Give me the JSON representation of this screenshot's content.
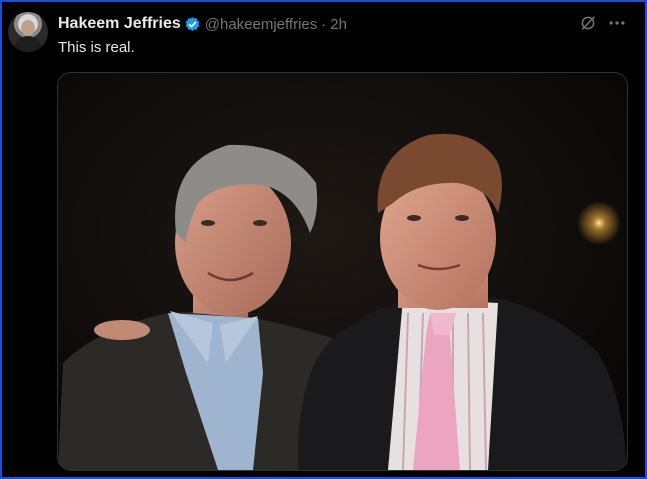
{
  "tweet": {
    "display_name": "Hakeem Jeffries",
    "handle": "@hakeemjeffries",
    "separator": "·",
    "timestamp": "2h",
    "verified": true,
    "text": "This is real."
  },
  "icons": {
    "avatar": "profile-avatar",
    "verified": "verified-badge-icon",
    "grok": "grok-icon",
    "more": "more-icon"
  },
  "colors": {
    "background": "#000000",
    "name": "#e7e9ea",
    "muted": "#71767b",
    "verified": "#1d9bf0",
    "frame": "#1d4ed8"
  }
}
